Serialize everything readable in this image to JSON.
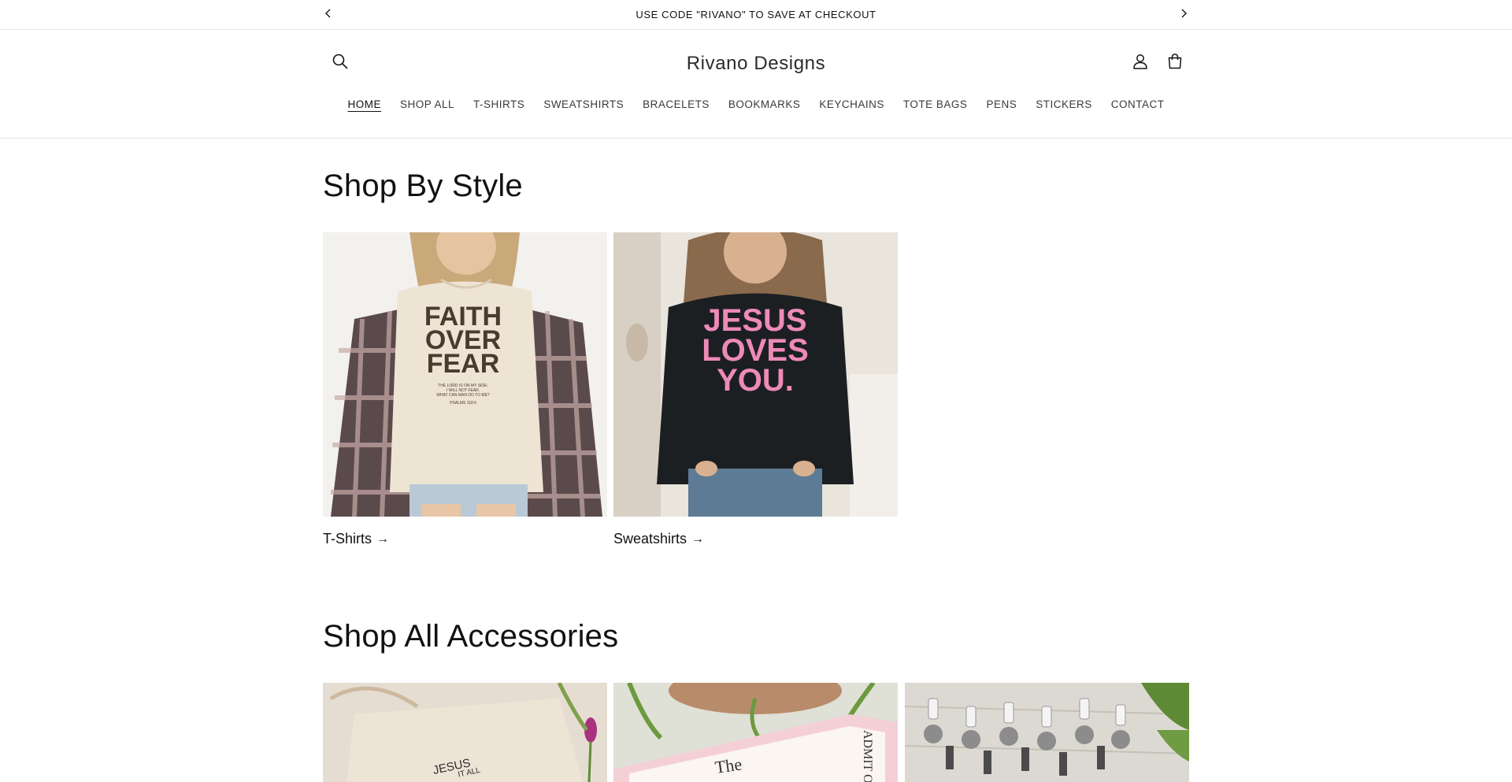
{
  "announcement": {
    "text": "USE CODE \"RIVANO\" TO SAVE AT CHECKOUT",
    "prev_icon": "chevron-left-icon",
    "next_icon": "chevron-right-icon"
  },
  "header": {
    "brand": "Rivano Designs",
    "icons": [
      "search-icon",
      "account-icon",
      "cart-icon"
    ]
  },
  "nav": {
    "items": [
      "HOME",
      "SHOP ALL",
      "T-SHIRTS",
      "SWEATSHIRTS",
      "BRACELETS",
      "BOOKMARKS",
      "KEYCHAINS",
      "TOTE BAGS",
      "PENS",
      "STICKERS",
      "CONTACT"
    ],
    "active": "HOME"
  },
  "shop_by_style": {
    "title": "Shop By Style",
    "cards": [
      {
        "label": "T-Shirts",
        "arrow": "→",
        "shirt_text": [
          "FAITH",
          "OVER",
          "FEAR"
        ],
        "shirt_small": [
          "THE LORD IS ON MY SIDE;",
          "I WILL NOT FEAR.",
          "WHAT CAN MAN DO TO ME?",
          "PSALMS 118:6"
        ]
      },
      {
        "label": "Sweatshirts",
        "arrow": "→",
        "shirt_text": [
          "JESUS",
          "LOVES",
          "YOU."
        ]
      }
    ]
  },
  "shop_all_accessories": {
    "title": "Shop All Accessories",
    "cards": [
      {
        "name": "tote-bag",
        "text": [
          "JESUS",
          "IT ALL"
        ]
      },
      {
        "name": "bookmark",
        "text": [
          "The",
          "ADMIT O"
        ]
      },
      {
        "name": "keychains",
        "text": []
      }
    ]
  },
  "colors": {
    "accent": "#121212",
    "border": "#e6e6e6",
    "tee": "#eee4d4",
    "sweatshirt": "#1c1f22",
    "pink": "#ee8ab7",
    "tee_print": "#4a3b30"
  }
}
